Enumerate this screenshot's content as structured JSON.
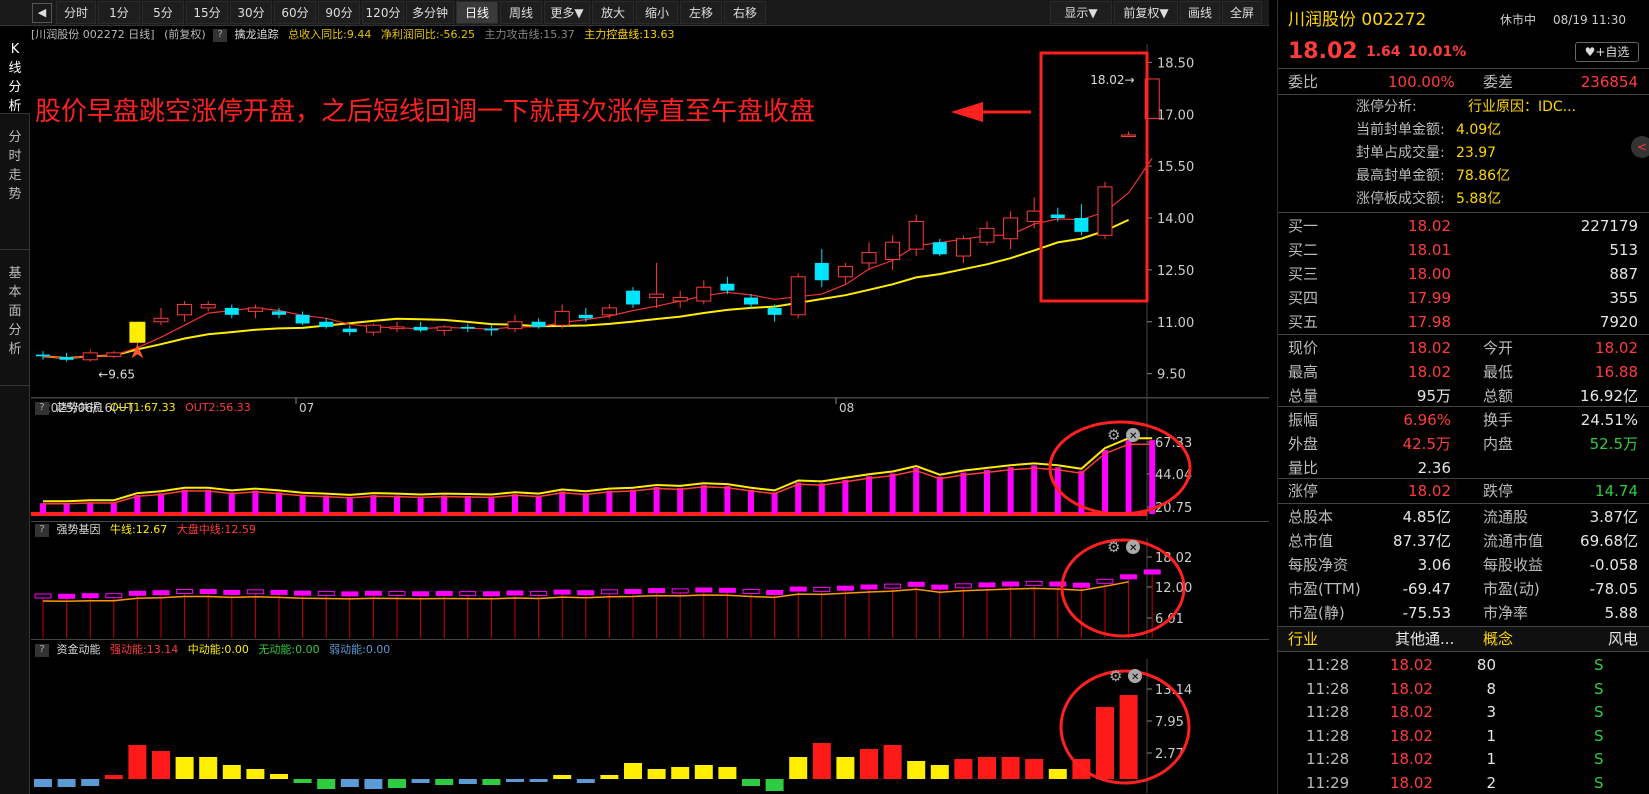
{
  "toolbar": {
    "nav_arrow": "◀",
    "periods": [
      "分时",
      "1分",
      "5分",
      "15分",
      "30分",
      "60分",
      "90分",
      "120分",
      "多分钟",
      "日线",
      "周线",
      "更多▼",
      "放大",
      "缩小",
      "左移",
      "右移"
    ],
    "active_period": "日线",
    "right_buttons": [
      "显示▼",
      "前复权▼",
      "画线",
      "全屏"
    ]
  },
  "left_tabs": [
    "K线分析",
    "分时走势",
    "基本面分析"
  ],
  "main_chart": {
    "header": {
      "title": "[川润股份 002272 日线]",
      "fq": "(前复权)",
      "indicator": "擒龙追踪",
      "rev_label": "总收入同比:9.44",
      "profit_label": "净利润同比:-56.25",
      "attack_label": "主力攻击线:15.37",
      "control_label": "主力控盘线:13.63"
    },
    "annotation": "股价早盘跳空涨停开盘，之后短线回调一下就再次涨停直至午盘收盘",
    "high_label": "18.02",
    "low_label": "9.65",
    "date_labels": [
      "2025/06/16(一)",
      "07",
      "08"
    ],
    "y_ticks": [
      "18.50",
      "17.00",
      "15.50",
      "14.00",
      "12.50",
      "11.00",
      "9.50"
    ]
  },
  "chart_data": {
    "type": "candlestick",
    "ylim": [
      9.2,
      18.8
    ],
    "candles": [
      [
        10.05,
        10.15,
        9.9,
        10.0
      ],
      [
        9.98,
        10.1,
        9.85,
        9.9
      ],
      [
        9.9,
        10.2,
        9.85,
        10.1
      ],
      [
        10.0,
        10.15,
        9.95,
        10.1
      ],
      [
        10.4,
        11.0,
        10.3,
        10.9
      ],
      [
        11.0,
        11.4,
        10.9,
        11.1
      ],
      [
        11.2,
        11.6,
        11.0,
        11.5
      ],
      [
        11.4,
        11.6,
        11.3,
        11.5
      ],
      [
        11.4,
        11.5,
        11.1,
        11.2
      ],
      [
        11.3,
        11.5,
        11.1,
        11.4
      ],
      [
        11.3,
        11.4,
        11.1,
        11.2
      ],
      [
        11.2,
        11.3,
        10.9,
        10.95
      ],
      [
        11.0,
        11.1,
        10.8,
        10.85
      ],
      [
        10.8,
        10.9,
        10.6,
        10.7
      ],
      [
        10.7,
        10.95,
        10.6,
        10.9
      ],
      [
        10.8,
        11.0,
        10.7,
        10.85
      ],
      [
        10.85,
        11.0,
        10.7,
        10.75
      ],
      [
        10.75,
        10.9,
        10.6,
        10.85
      ],
      [
        10.85,
        10.95,
        10.7,
        10.8
      ],
      [
        10.8,
        10.9,
        10.6,
        10.75
      ],
      [
        10.8,
        11.2,
        10.7,
        11.0
      ],
      [
        11.0,
        11.1,
        10.8,
        10.85
      ],
      [
        10.9,
        11.5,
        10.8,
        11.3
      ],
      [
        11.2,
        11.4,
        11.0,
        11.1
      ],
      [
        11.2,
        11.5,
        11.1,
        11.4
      ],
      [
        11.9,
        12.0,
        11.4,
        11.5
      ],
      [
        11.7,
        12.7,
        11.4,
        11.8
      ],
      [
        11.6,
        11.9,
        11.4,
        11.7
      ],
      [
        11.6,
        12.2,
        11.5,
        12.0
      ],
      [
        12.1,
        12.3,
        11.8,
        11.9
      ],
      [
        11.7,
        11.8,
        11.4,
        11.5
      ],
      [
        11.4,
        11.5,
        11.0,
        11.2
      ],
      [
        11.2,
        12.4,
        11.1,
        12.3
      ],
      [
        12.7,
        13.1,
        12.0,
        12.2
      ],
      [
        12.3,
        12.7,
        12.1,
        12.6
      ],
      [
        12.7,
        13.3,
        12.5,
        13.0
      ],
      [
        12.8,
        13.5,
        12.5,
        13.3
      ],
      [
        13.1,
        14.1,
        12.9,
        13.9
      ],
      [
        13.3,
        13.4,
        12.9,
        12.95
      ],
      [
        12.9,
        13.5,
        12.7,
        13.4
      ],
      [
        13.3,
        13.9,
        13.2,
        13.7
      ],
      [
        13.4,
        14.2,
        13.1,
        14.0
      ],
      [
        13.9,
        14.6,
        13.7,
        14.2
      ],
      [
        14.1,
        14.3,
        13.9,
        14.0
      ],
      [
        14.0,
        14.4,
        13.5,
        13.6
      ],
      [
        13.5,
        15.05,
        13.4,
        14.9
      ],
      [
        16.4,
        16.5,
        16.4,
        16.4
      ],
      [
        16.88,
        18.02,
        16.88,
        18.02
      ]
    ]
  },
  "osc1": {
    "header": {
      "name": "趋势共振",
      "out1": "OUT1:67.33",
      "out2": "OUT2:56.33"
    },
    "y_ticks": [
      "67.33",
      "44.04",
      "20.75"
    ]
  },
  "osc2": {
    "header": {
      "name": "强势基因",
      "bull": "牛线:12.67",
      "mid": "大盘中线:12.59"
    },
    "y_ticks": [
      "18.02",
      "12.00",
      "6.01"
    ]
  },
  "osc3": {
    "header": {
      "name": "资金动能",
      "strong": "强动能:13.14",
      "mid": "中动能:0.00",
      "none": "无动能:0.00",
      "weak": "弱动能:0.00"
    },
    "y_ticks": [
      "13.14",
      "7.95",
      "2.77"
    ]
  },
  "right_panel": {
    "stock_name": "川润股份 002272",
    "status": "休市中",
    "datetime": "08/19 11:30",
    "price": "18.02",
    "change": "1.64",
    "change_pct": "10.01%",
    "fav_button": "+自选",
    "weibi_label": "委比",
    "weibi": "100.00%",
    "weicha_label": "委差",
    "weicha": "236854",
    "limit_info": [
      {
        "label": "涨停分析:",
        "value": "行业原因：IDC..."
      },
      {
        "label": "当前封单金额:",
        "value": "4.09亿"
      },
      {
        "label": "封单占成交量:",
        "value": "23.97"
      },
      {
        "label": "最高封单金额:",
        "value": "78.86亿"
      },
      {
        "label": "涨停板成交额:",
        "value": "5.88亿"
      }
    ],
    "bids": [
      {
        "label": "买一",
        "price": "18.02",
        "vol": "227179"
      },
      {
        "label": "买二",
        "price": "18.01",
        "vol": "513"
      },
      {
        "label": "买三",
        "price": "18.00",
        "vol": "887"
      },
      {
        "label": "买四",
        "price": "17.99",
        "vol": "355"
      },
      {
        "label": "买五",
        "price": "17.98",
        "vol": "7920"
      }
    ],
    "quote": [
      {
        "l1": "现价",
        "v1": "18.02",
        "c1": "red",
        "l2": "今开",
        "v2": "18.02",
        "c2": "red"
      },
      {
        "l1": "最高",
        "v1": "18.02",
        "c1": "red",
        "l2": "最低",
        "v2": "16.88",
        "c2": "red"
      },
      {
        "l1": "总量",
        "v1": "95万",
        "c1": "white",
        "l2": "总额",
        "v2": "16.92亿",
        "c2": "white"
      }
    ],
    "stats": [
      {
        "l1": "振幅",
        "v1": "6.96%",
        "c1": "red",
        "l2": "换手",
        "v2": "24.51%",
        "c2": "white"
      },
      {
        "l1": "外盘",
        "v1": "42.5万",
        "c1": "red",
        "l2": "内盘",
        "v2": "52.5万",
        "c2": "green"
      },
      {
        "l1": "量比",
        "v1": "2.36",
        "c1": "white",
        "l2": "",
        "v2": "",
        "c2": "white"
      }
    ],
    "limits": {
      "l1": "涨停",
      "v1": "18.02",
      "l2": "跌停",
      "v2": "14.74"
    },
    "fundamentals": [
      {
        "l1": "总股本",
        "v1": "4.85亿",
        "l2": "流通股",
        "v2": "3.87亿"
      },
      {
        "l1": "总市值",
        "v1": "87.37亿",
        "l2": "流通市值",
        "v2": "69.68亿"
      },
      {
        "l1": "每股净资",
        "v1": "3.06",
        "l2": "每股收益",
        "v2": "-0.058"
      },
      {
        "l1": "市盈(TTM)",
        "v1": "-69.47",
        "l2": "市盈(动)",
        "v2": "-78.05"
      },
      {
        "l1": "市盈(静)",
        "v1": "-75.53",
        "l2": "市净率",
        "v2": "5.88"
      }
    ],
    "category": {
      "l1": "行业",
      "v1": "其他通...",
      "l2": "概念",
      "v2": "风电"
    },
    "ticks": [
      {
        "time": "11:28",
        "price": "18.02",
        "vol": "80",
        "side": "S"
      },
      {
        "time": "11:28",
        "price": "18.02",
        "vol": "8",
        "side": "S"
      },
      {
        "time": "11:28",
        "price": "18.02",
        "vol": "3",
        "side": "S"
      },
      {
        "time": "11:28",
        "price": "18.02",
        "vol": "1",
        "side": "S"
      },
      {
        "time": "11:28",
        "price": "18.02",
        "vol": "1",
        "side": "S"
      },
      {
        "time": "11:29",
        "price": "18.02",
        "vol": "2",
        "side": "S"
      }
    ]
  }
}
